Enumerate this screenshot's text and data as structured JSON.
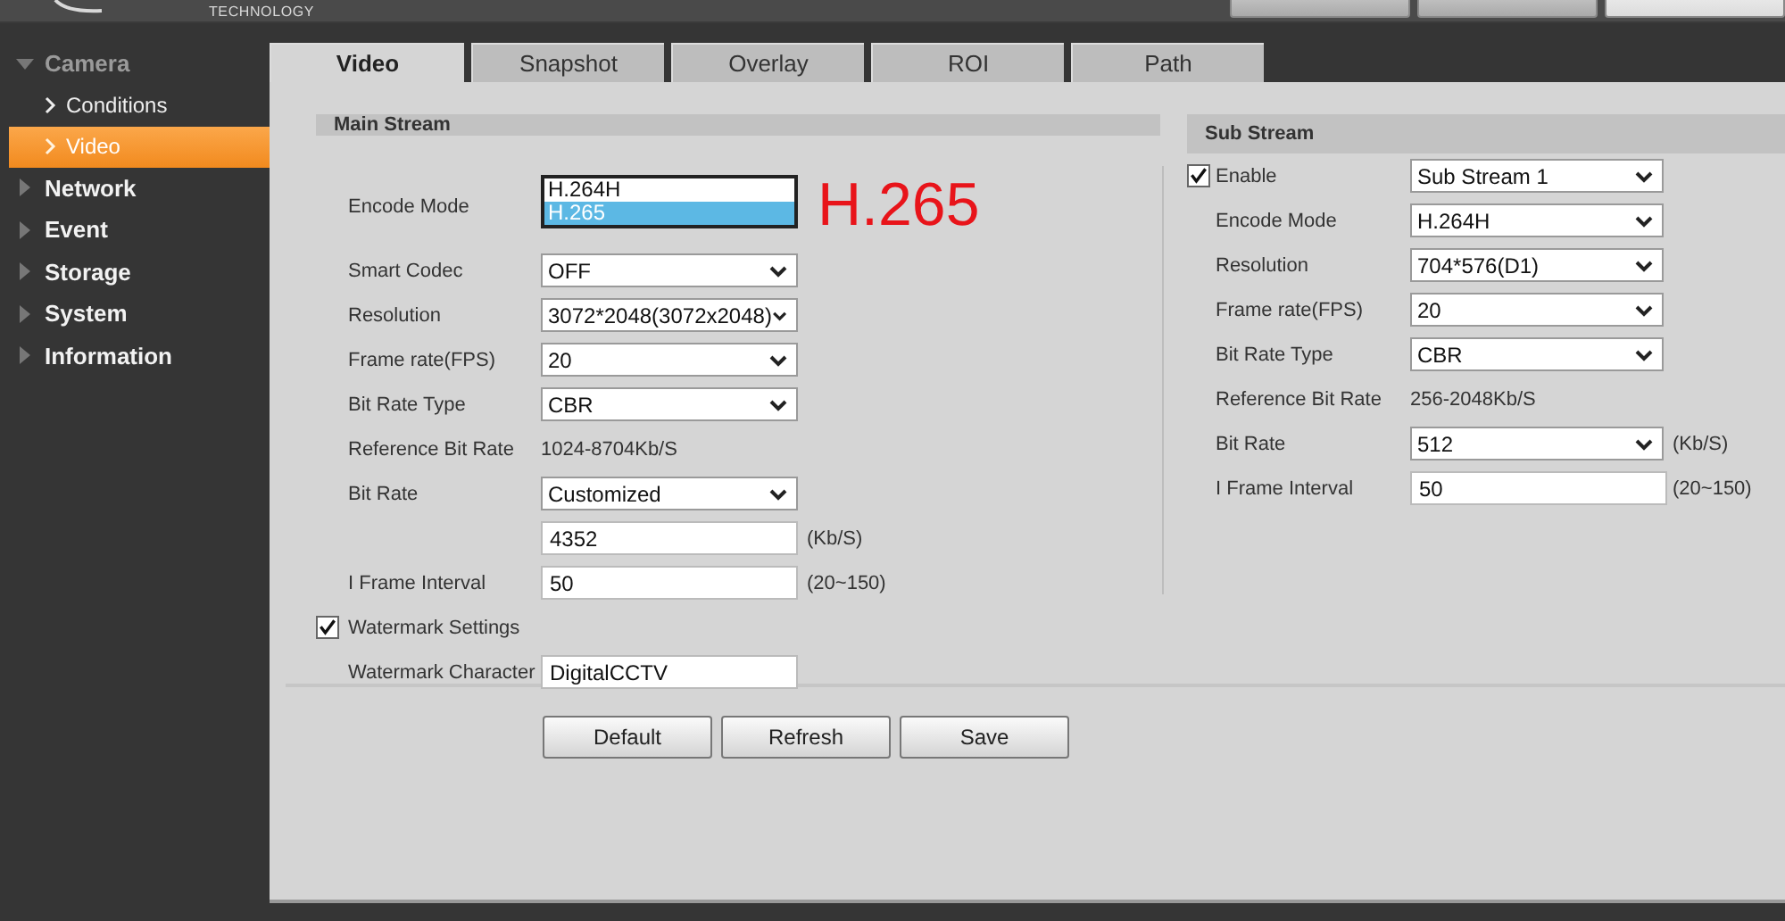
{
  "logo": {
    "text": "TECHNOLOGY"
  },
  "top_nav": [
    {
      "selected": false
    },
    {
      "selected": false
    },
    {
      "selected": true
    }
  ],
  "sidebar": {
    "items": [
      {
        "label": "Camera",
        "expanded": true,
        "children": [
          {
            "label": "Conditions",
            "selected": false
          },
          {
            "label": "Video",
            "selected": true
          }
        ]
      },
      {
        "label": "Network",
        "expanded": false
      },
      {
        "label": "Event",
        "expanded": false
      },
      {
        "label": "Storage",
        "expanded": false
      },
      {
        "label": "System",
        "expanded": false
      },
      {
        "label": "Information",
        "expanded": false
      }
    ]
  },
  "tabs": [
    {
      "label": "Video",
      "selected": true
    },
    {
      "label": "Snapshot",
      "selected": false
    },
    {
      "label": "Overlay",
      "selected": false
    },
    {
      "label": "ROI",
      "selected": false
    },
    {
      "label": "Path",
      "selected": false
    }
  ],
  "main_stream": {
    "title": "Main Stream",
    "rows": [
      {
        "kind": "listbox",
        "label": "Encode Mode",
        "options": [
          {
            "label": "H.264H",
            "selected": false
          },
          {
            "label": "H.265",
            "selected": true
          }
        ]
      },
      {
        "kind": "select",
        "label": "Smart Codec",
        "value": "OFF"
      },
      {
        "kind": "select",
        "label": "Resolution",
        "value": "3072*2048(3072x2048)"
      },
      {
        "kind": "select",
        "label": "Frame rate(FPS)",
        "value": "20"
      },
      {
        "kind": "select",
        "label": "Bit Rate Type",
        "value": "CBR"
      },
      {
        "kind": "text",
        "label": "Reference Bit Rate",
        "value": "1024-8704Kb/S"
      },
      {
        "kind": "select",
        "label": "Bit Rate",
        "value": "Customized"
      },
      {
        "kind": "input",
        "value": "4352",
        "unit": "(Kb/S)"
      },
      {
        "kind": "input",
        "label": "I Frame Interval",
        "value": "50",
        "unit": "(20~150)"
      },
      {
        "kind": "checkbox",
        "label": "Watermark Settings",
        "checked": true
      },
      {
        "kind": "input",
        "label": "Watermark Character",
        "value": "DigitalCCTV"
      }
    ]
  },
  "annotation": "H.265",
  "sub_stream": {
    "title": "Sub Stream",
    "rows": [
      {
        "kind": "checkselect",
        "label": "Enable",
        "checked": true,
        "value": "Sub Stream 1"
      },
      {
        "kind": "select",
        "label": "Encode Mode",
        "value": "H.264H"
      },
      {
        "kind": "select",
        "label": "Resolution",
        "value": "704*576(D1)"
      },
      {
        "kind": "select",
        "label": "Frame rate(FPS)",
        "value": "20"
      },
      {
        "kind": "select",
        "label": "Bit Rate Type",
        "value": "CBR"
      },
      {
        "kind": "text",
        "label": "Reference Bit Rate",
        "value": "256-2048Kb/S"
      },
      {
        "kind": "select",
        "label": "Bit Rate",
        "value": "512",
        "unit": "(Kb/S)"
      },
      {
        "kind": "input",
        "label": "I Frame Interval",
        "value": "50",
        "unit": "(20~150)"
      }
    ]
  },
  "buttons": [
    "Default",
    "Refresh",
    "Save"
  ]
}
